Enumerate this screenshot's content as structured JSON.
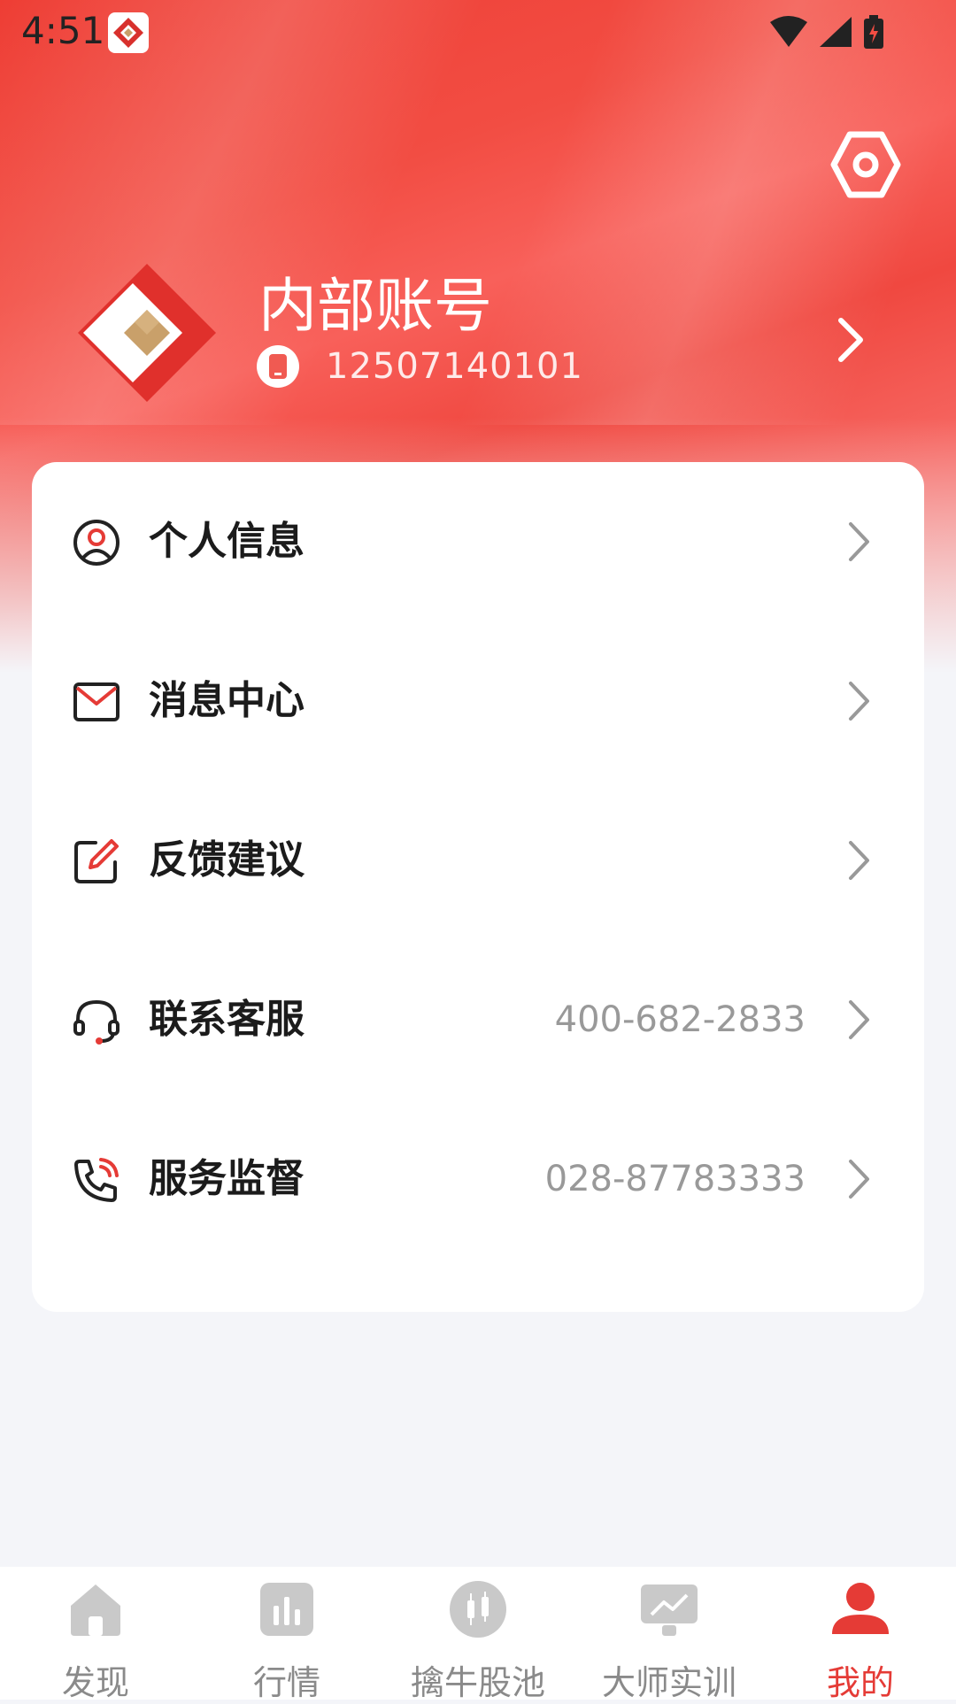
{
  "status_bar": {
    "time": "4:51",
    "icons": [
      "app-logo-icon",
      "wifi-icon",
      "signal-icon",
      "battery-charging-icon"
    ]
  },
  "profile": {
    "account_name": "内部账号",
    "phone": "12507140101",
    "avatar_icon": "brand-logo-icon",
    "settings_icon": "settings-hexagon-icon",
    "arrow_icon": "chevron-right-icon"
  },
  "menu": {
    "items": [
      {
        "label": "个人信息",
        "icon": "user-circle-icon",
        "value": ""
      },
      {
        "label": "消息中心",
        "icon": "mail-icon",
        "value": ""
      },
      {
        "label": "反馈建议",
        "icon": "edit-icon",
        "value": ""
      },
      {
        "label": "联系客服",
        "icon": "headset-icon",
        "value": "400-682-2833"
      },
      {
        "label": "服务监督",
        "icon": "phone-call-icon",
        "value": "028-87783333"
      }
    ]
  },
  "tabbar": {
    "tabs": [
      {
        "label": "发现",
        "icon": "home-icon",
        "active": false
      },
      {
        "label": "行情",
        "icon": "bar-chart-icon",
        "active": false
      },
      {
        "label": "擒牛股池",
        "icon": "candlestick-icon",
        "active": false
      },
      {
        "label": "大师实训",
        "icon": "presentation-icon",
        "active": false
      },
      {
        "label": "我的",
        "icon": "person-icon",
        "active": true
      }
    ]
  },
  "colors": {
    "brand_red": "#e53b36",
    "header_red": "#f24d43",
    "background": "#f4f5f9",
    "inactive_tab": "#c9c9c9"
  }
}
